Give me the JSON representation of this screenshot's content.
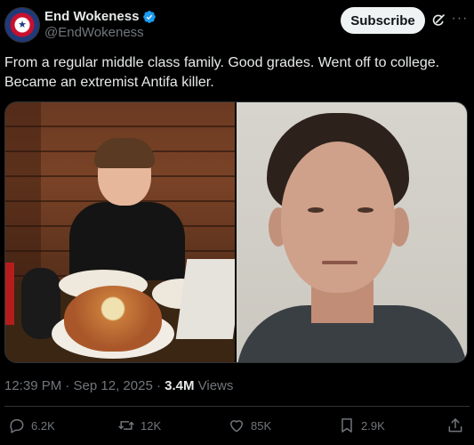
{
  "author": {
    "name": "End Wokeness",
    "handle": "@EndWokeness",
    "avatar_icon": "eagle-seal-avatar",
    "verified_color": "#1d9bf0"
  },
  "header": {
    "subscribe_label": "Subscribe",
    "grok_icon": "grok-icon",
    "more_icon": "more-icon"
  },
  "tweet": {
    "text": "From a regular middle class family. Good grades. Went off to college. Became an extremist Antifa killer."
  },
  "media": [
    {
      "kind": "photo",
      "subject": "boy-at-restaurant-table"
    },
    {
      "kind": "photo",
      "subject": "adult-man-mugshot"
    }
  ],
  "meta": {
    "time_date": "12:39 PM · Sep 12, 2025 · ",
    "views_count": "3.4M",
    "views_label": " Views"
  },
  "actions": {
    "reply": "6.2K",
    "retweet": "12K",
    "like": "85K",
    "bookmark": "2.9K"
  },
  "colors": {
    "background": "#000000",
    "text": "#e7e9ea",
    "muted": "#71767b",
    "button_bg": "#eff3f4"
  }
}
